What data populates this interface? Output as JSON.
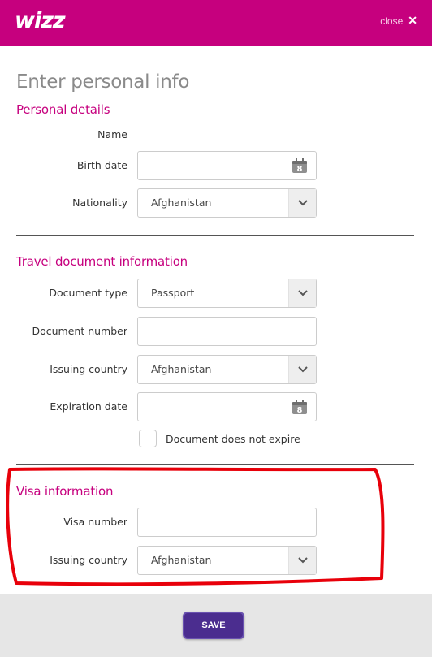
{
  "header": {
    "logo": "wizz",
    "close_label": "close",
    "close_icon": "close-icon"
  },
  "page_title": "Enter personal info",
  "personal": {
    "title": "Personal details",
    "name_label": "Name",
    "name_value": "",
    "birth_label": "Birth date",
    "birth_value": "",
    "birth_icon": "8",
    "nationality_label": "Nationality",
    "nationality_value": "Afghanistan"
  },
  "travel": {
    "title": "Travel document information",
    "doctype_label": "Document type",
    "doctype_value": "Passport",
    "docnum_label": "Document number",
    "docnum_value": "",
    "issuing_label": "Issuing country",
    "issuing_value": "Afghanistan",
    "expiry_label": "Expiration date",
    "expiry_value": "",
    "expiry_icon": "8",
    "not_expire_label": "Document does not expire"
  },
  "visa": {
    "title": "Visa information",
    "number_label": "Visa number",
    "number_value": "",
    "issuing_label": "Issuing country",
    "issuing_value": "Afghanistan"
  },
  "footer": {
    "save_label": "SAVE"
  },
  "colors": {
    "brand": "#c6007e",
    "button": "#4b2d8f",
    "annotation": "#e8000a"
  }
}
